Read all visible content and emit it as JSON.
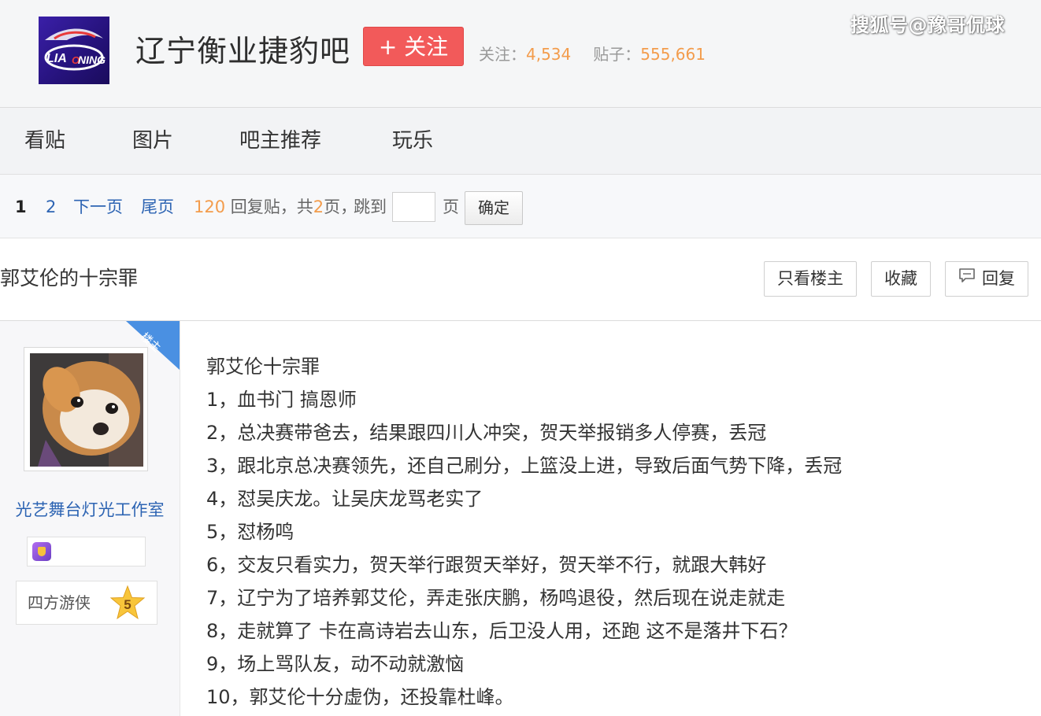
{
  "watermark": "搜狐号@豫哥侃球",
  "header": {
    "forum_name": "辽宁衡业捷豹吧",
    "follow_button": "+ 关注",
    "follow_label": "关注：",
    "follow_count": "4,534",
    "posts_label": "贴子：",
    "posts_count": "555,661"
  },
  "nav": {
    "items": [
      {
        "label": "看贴"
      },
      {
        "label": "图片"
      },
      {
        "label": "吧主推荐"
      },
      {
        "label": "玩乐"
      }
    ]
  },
  "pager": {
    "current": "1",
    "page2": "2",
    "next": "下一页",
    "last": "尾页",
    "reply_count": "120",
    "reply_text": "回复贴，共",
    "total_pages": "2",
    "pages_suffix": "页，",
    "jump_to": "跳到",
    "page_unit": "页",
    "confirm": "确定"
  },
  "thread": {
    "title": "郭艾伦的十宗罪",
    "only_op_button": "只看楼主",
    "favorite_button": "收藏",
    "reply_button": "回复"
  },
  "post": {
    "op_tag": "楼主",
    "username": "光艺舞台灯光工作室",
    "level_title": "四方游侠",
    "level": "5",
    "lines": [
      "郭艾伦十宗罪",
      "1，血书门 搞恩师",
      "2，总决赛带爸去，结果跟四川人冲突，贺天举报销多人停赛，丢冠",
      "3，跟北京总决赛领先，还自己刷分，上篮没上进，导致后面气势下降，丢冠",
      "4，怼吴庆龙。让吴庆龙骂老实了",
      "5，怼杨鸣",
      "6，交友只看实力，贺天举行跟贺天举好，贺天举不行，就跟大韩好",
      "7，辽宁为了培养郭艾伦，弄走张庆鹏，杨鸣退役，然后现在说走就走",
      "8，走就算了 卡在高诗岩去山东，后卫没人用，还跑 这不是落井下石？",
      "9，场上骂队友，动不动就激恼",
      "10，郭艾伦十分虚伪，还投靠杜峰。"
    ]
  },
  "logo": {
    "text": "LIAONING",
    "colors": {
      "bg": "#2a158a",
      "accent": "#e83a3a"
    }
  },
  "colors": {
    "link": "#2d64b3",
    "orange": "#f39c4c",
    "follow_btn": "#f25a5a",
    "op_tag": "#4a90e2"
  }
}
